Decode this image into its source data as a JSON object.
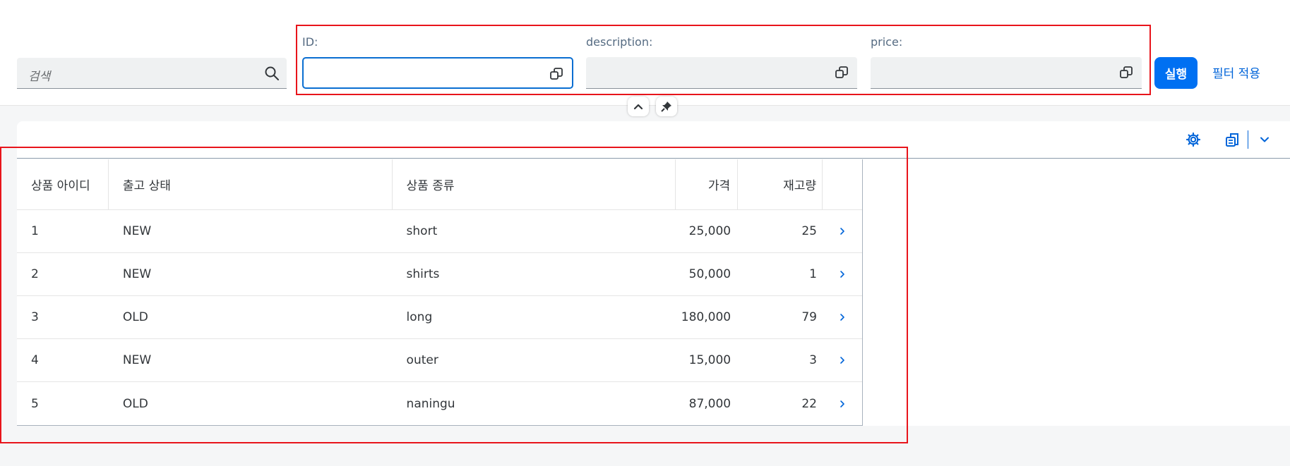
{
  "search": {
    "placeholder": "검색"
  },
  "filters": [
    {
      "label": "ID:",
      "value": ""
    },
    {
      "label": "description:",
      "value": ""
    },
    {
      "label": "price:",
      "value": ""
    }
  ],
  "actions": {
    "go": "실행",
    "adapt": "필터 적용"
  },
  "table": {
    "columns": [
      "상품 아이디",
      "출고 상태",
      "상품 종류",
      "가격",
      "재고량"
    ],
    "rows": [
      {
        "id": "1",
        "status": "NEW",
        "type": "short",
        "price": "25,000",
        "stock": "25"
      },
      {
        "id": "2",
        "status": "NEW",
        "type": "shirts",
        "price": "50,000",
        "stock": "1"
      },
      {
        "id": "3",
        "status": "OLD",
        "type": "long",
        "price": "180,000",
        "stock": "79"
      },
      {
        "id": "4",
        "status": "NEW",
        "type": "outer",
        "price": "15,000",
        "stock": "3"
      },
      {
        "id": "5",
        "status": "OLD",
        "type": "naningu",
        "price": "87,000",
        "stock": "22"
      }
    ]
  },
  "colors": {
    "accent": "#0070f2",
    "highlight": "#e8141b",
    "link": "#0064d9"
  },
  "icons": [
    "search-icon",
    "value-help-icon",
    "collapse-icon",
    "pin-icon",
    "settings-icon",
    "export-icon",
    "chevron-down-icon",
    "row-navigation-icon"
  ]
}
